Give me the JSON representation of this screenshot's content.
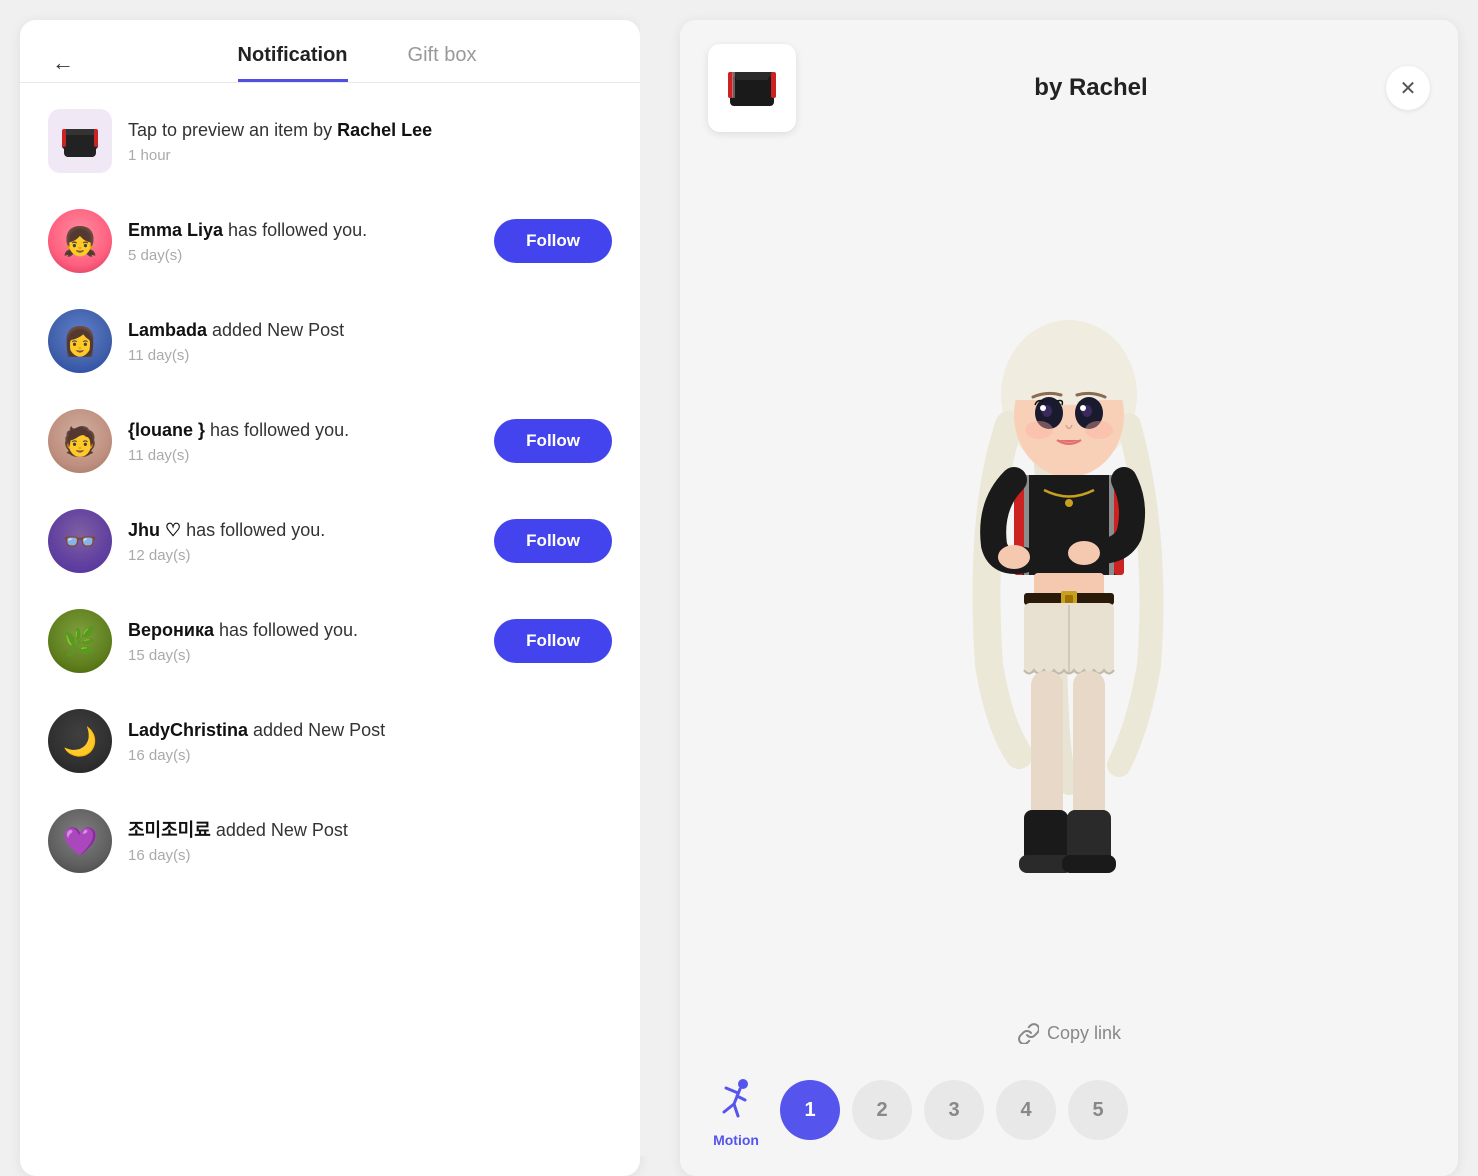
{
  "left": {
    "back_label": "←",
    "tabs": [
      {
        "label": "Notification",
        "active": true
      },
      {
        "label": "Gift box",
        "active": false
      }
    ],
    "notifications": [
      {
        "id": "rachel-item",
        "type": "item",
        "text_before": "Tap to preview an item by ",
        "text_bold": "Rachel Lee",
        "text_after": "",
        "time": "1 hour",
        "has_follow": false,
        "avatar_type": "item"
      },
      {
        "id": "emma-liya",
        "type": "follow",
        "text_before": "",
        "text_bold": "Emma Liya",
        "text_after": " has followed you.",
        "time": "5 day(s)",
        "has_follow": true,
        "avatar_type": "avatar",
        "avatar_class": "avatar-emma"
      },
      {
        "id": "lambada",
        "type": "post",
        "text_before": "",
        "text_bold": "Lambada",
        "text_after": " added New Post",
        "time": "11 day(s)",
        "has_follow": false,
        "avatar_type": "avatar",
        "avatar_class": "avatar-lambada"
      },
      {
        "id": "louane",
        "type": "follow",
        "text_before": "",
        "text_bold": "{louane }",
        "text_after": " has followed you.",
        "time": "11 day(s)",
        "has_follow": true,
        "avatar_type": "avatar",
        "avatar_class": "avatar-louane"
      },
      {
        "id": "jhu",
        "type": "follow",
        "text_before": "",
        "text_bold": "Jhu ♡",
        "text_after": " has followed you.",
        "time": "12 day(s)",
        "has_follow": true,
        "avatar_type": "avatar",
        "avatar_class": "avatar-jhu"
      },
      {
        "id": "veronika",
        "type": "follow",
        "text_before": "",
        "text_bold": "Вероника",
        "text_after": " has followed you.",
        "time": "15 day(s)",
        "has_follow": true,
        "avatar_type": "avatar",
        "avatar_class": "avatar-veronika"
      },
      {
        "id": "ladychristina",
        "type": "post",
        "text_before": "",
        "text_bold": "LadyChristina",
        "text_after": " added New Post",
        "time": "16 day(s)",
        "has_follow": false,
        "avatar_type": "avatar",
        "avatar_class": "avatar-ladychristina"
      },
      {
        "id": "jomijomi",
        "type": "post",
        "text_before": "",
        "text_bold": "조미조미료",
        "text_after": " added New Post",
        "time": "16 day(s)",
        "has_follow": false,
        "avatar_type": "avatar",
        "avatar_class": "avatar-jomi"
      }
    ],
    "follow_label": "Follow"
  },
  "right": {
    "title": "by Rachel",
    "close_label": "✕",
    "copy_link_label": "Copy link",
    "motion_label": "Motion",
    "pages": [
      "1",
      "2",
      "3",
      "4",
      "5"
    ],
    "active_page": 0
  }
}
